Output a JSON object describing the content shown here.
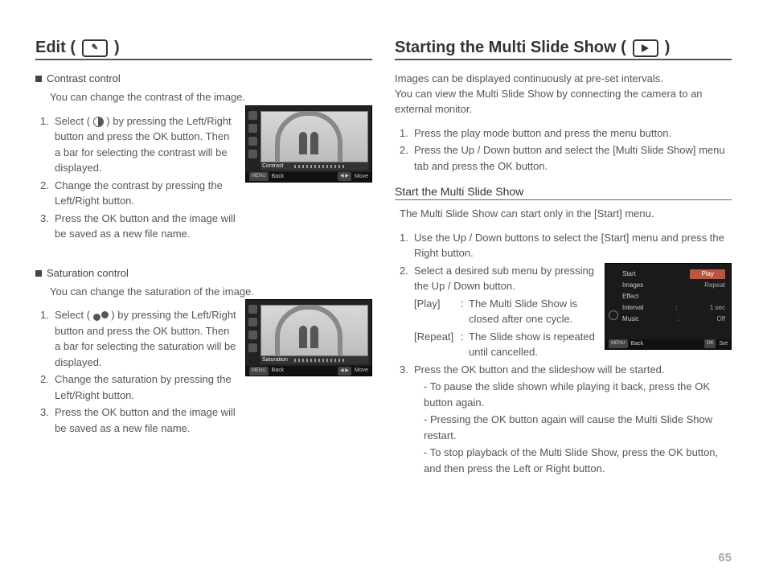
{
  "page_number": "65",
  "left": {
    "title_pre": "Edit (",
    "title_post": " )",
    "icon_name": "edit-icon",
    "contrast": {
      "heading": "Contrast control",
      "desc": "You can change the contrast of the image.",
      "steps": [
        "Select ( [contrast-icon] ) by pressing the Left/Right button and press the OK button. Then a bar for selecting the contrast will be displayed.",
        "Change the contrast by pressing the Left/Right button.",
        "Press the OK button and the image will be saved as a new file name."
      ],
      "shot": {
        "label": "Contrast",
        "back_btn": "MENU",
        "back_lbl": "Back",
        "move_btn": "◀ ▶",
        "move_lbl": "Move"
      }
    },
    "saturation": {
      "heading": "Saturation control",
      "desc": "You can change the saturation of the image.",
      "steps": [
        "Select ( [saturation-icon] ) by pressing the Left/Right button and press the OK button. Then a bar for selecting the saturation will be displayed.",
        "Change the saturation by pressing the Left/Right button.",
        "Press the OK button and the image will be saved as a new file name."
      ],
      "shot": {
        "label": "Saturation",
        "back_btn": "MENU",
        "back_lbl": "Back",
        "move_btn": "◀ ▶",
        "move_lbl": "Move"
      }
    }
  },
  "right": {
    "title_pre": "Starting the Multi Slide Show (",
    "title_post": " )",
    "icon_name": "play-icon",
    "intro1": "Images can be displayed continuously at pre-set intervals.",
    "intro2": "You can view the Multi Slide Show by connecting the camera to an external monitor.",
    "top_steps": [
      "Press the play mode button and press the menu button.",
      "Press the Up / Down button and select the [Multi Slide Show] menu tab and press the OK button."
    ],
    "start": {
      "heading": "Start the Multi Slide Show",
      "note": "The Multi Slide Show can start only in the [Start] menu.",
      "step1": "Use the Up / Down buttons to select the [Start] menu and press the Right button.",
      "step2_lead": "Select a desired sub menu by pressing the Up / Down button.",
      "options": [
        {
          "k": "[Play]",
          "v": "The Multi Slide Show is closed after one cycle."
        },
        {
          "k": "[Repeat]",
          "v": "The Slide show is repeated until cancelled."
        }
      ],
      "step3": "Press the OK button and the slideshow will be started.",
      "step3_subs": [
        "To pause the slide shown while playing it back, press the OK button again.",
        "Pressing the OK button again will cause the Multi Slide Show restart.",
        "To stop playback of the Multi Slide Show, press the OK button, and then press the Left or Right button."
      ],
      "menu_shot": {
        "rows": [
          {
            "l": "Start",
            "r": "Play",
            "sel": true
          },
          {
            "l": "Images",
            "r": "Repeat"
          },
          {
            "l": "Effect",
            "r": ""
          },
          {
            "l": "Interval",
            "r": "1 sec"
          },
          {
            "l": "Music",
            "r": "Off"
          }
        ],
        "back_btn": "MENU",
        "back_lbl": "Back",
        "set_btn": "OK",
        "set_lbl": "Set"
      }
    }
  }
}
